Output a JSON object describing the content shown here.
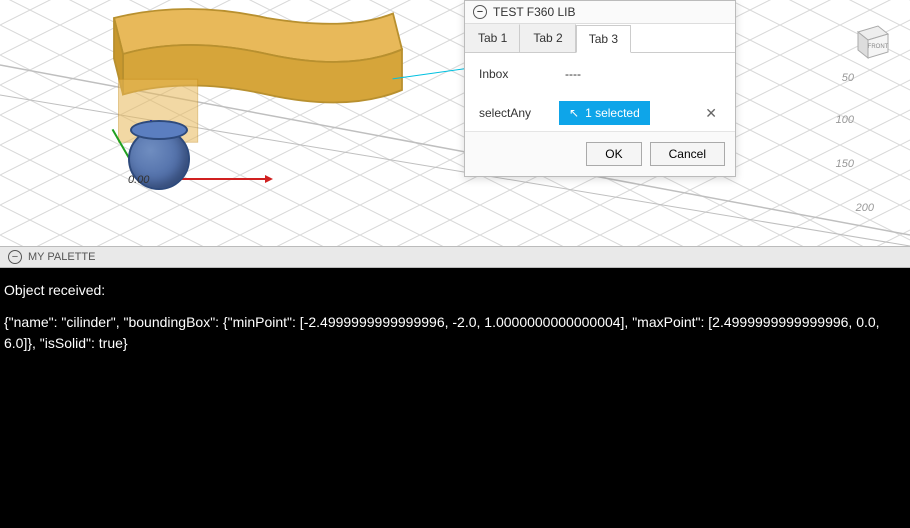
{
  "dialog": {
    "title": "TEST F360 LIB",
    "tabs": [
      "Tab 1",
      "Tab 2",
      "Tab 3"
    ],
    "active_tab_index": 2,
    "inbox_label": "Inbox",
    "inbox_value": "----",
    "select_label": "selectAny",
    "selected_chip": "1 selected",
    "remove_icon": "✕",
    "ok_label": "OK",
    "cancel_label": "Cancel"
  },
  "palette": {
    "title": "MY PALETTE",
    "line1": "Object received:",
    "line2": "{\"name\": \"cilinder\", \"boundingBox\": {\"minPoint\": [-2.4999999999999996, -2.0, 1.0000000000000004], \"maxPoint\": [2.4999999999999996, 0.0, 6.0]}, \"isSolid\": true}"
  },
  "navcube": {
    "face": "FRONT"
  },
  "rulers": {
    "a": "50",
    "b": "100",
    "c": "150",
    "d": "200"
  },
  "axis_readout": "0.00",
  "icons": {
    "collapse": "−",
    "cursor": "↖"
  }
}
